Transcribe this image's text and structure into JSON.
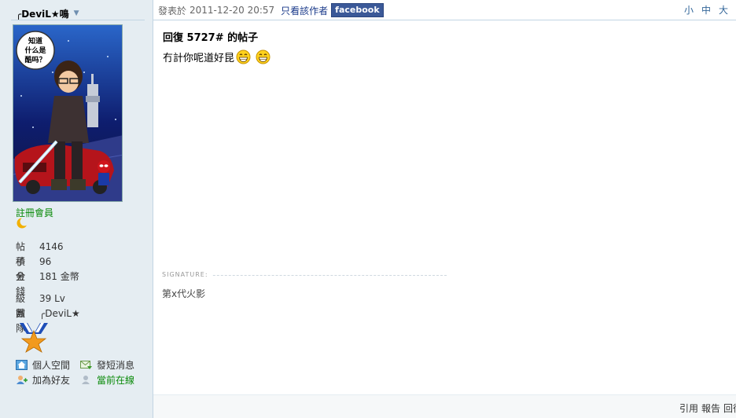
{
  "user": {
    "name": "╭DeviL★鳴",
    "group": "註冊會員",
    "avatar_speech": [
      "知道",
      "什么是",
      "酷吗？"
    ],
    "stats": [
      {
        "label": "帖子",
        "value": "4146"
      },
      {
        "label": "積分",
        "value": "96"
      },
      {
        "label": "金錢",
        "value": "181 金幣"
      }
    ],
    "stats2": [
      {
        "label": "級數",
        "value": "39 Lv"
      },
      {
        "label": "團隊",
        "value": "╭DeviL★"
      }
    ],
    "actions": {
      "space": "個人空間",
      "pm": "發短消息",
      "friend": "加為好友",
      "online": "當前在線"
    }
  },
  "post": {
    "prefix": "發表於",
    "datetime": "2011-12-20 20:57",
    "author_only": "只看該作者",
    "facebook": "facebook",
    "sizes": [
      "小",
      "中",
      "大"
    ],
    "title": "回復 5727# 的帖子",
    "body": "冇計你呢道好昆",
    "signature_label": "SIGNATURE:",
    "signature": "第x代火影"
  },
  "footer": {
    "quote": "引用",
    "report": "報告",
    "reply": "回復"
  },
  "colors": {
    "sidebar_bg": "#E5EDF2",
    "border": "#C2D5E3",
    "group_green": "#0a8a0a",
    "link_blue": "#336699",
    "facebook_blue": "#3b5998"
  }
}
